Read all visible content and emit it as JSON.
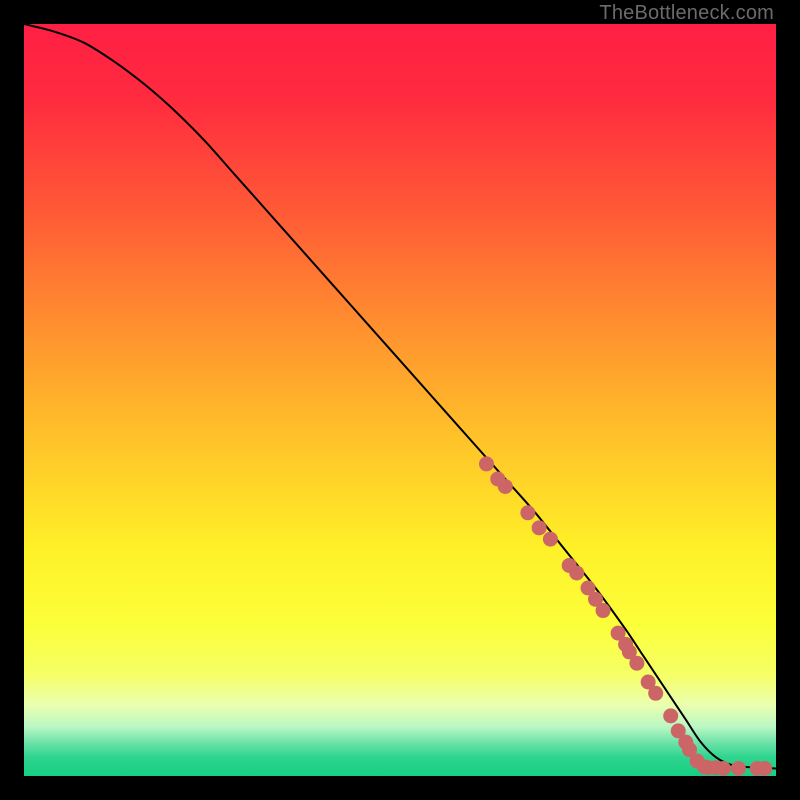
{
  "watermark": "TheBottleneck.com",
  "chart_data": {
    "type": "line",
    "title": "",
    "xlabel": "",
    "ylabel": "",
    "xlim": [
      0,
      100
    ],
    "ylim": [
      0,
      100
    ],
    "grid": false,
    "legend": false,
    "series": [
      {
        "name": "curve",
        "x": [
          0,
          4,
          8,
          12,
          16,
          20,
          24,
          28,
          32,
          36,
          40,
          44,
          48,
          52,
          56,
          60,
          64,
          68,
          72,
          76,
          80,
          82,
          84,
          86,
          88,
          90,
          92,
          94,
          96,
          98,
          100
        ],
        "y": [
          100,
          99,
          97.5,
          95,
          92,
          88.5,
          84.5,
          80,
          75.5,
          71,
          66.5,
          62,
          57.5,
          53,
          48.5,
          44,
          39.5,
          35,
          30,
          25,
          19.5,
          16.5,
          13.5,
          10.5,
          7.5,
          4.5,
          2.5,
          1.5,
          1.2,
          1.1,
          1.0
        ]
      }
    ],
    "markers": {
      "name": "dots",
      "color": "#cc6666",
      "points": [
        {
          "x": 61.5,
          "y": 41.5
        },
        {
          "x": 63.0,
          "y": 39.5
        },
        {
          "x": 64.0,
          "y": 38.5
        },
        {
          "x": 67.0,
          "y": 35.0
        },
        {
          "x": 68.5,
          "y": 33.0
        },
        {
          "x": 70.0,
          "y": 31.5
        },
        {
          "x": 72.5,
          "y": 28.0
        },
        {
          "x": 73.5,
          "y": 27.0
        },
        {
          "x": 75.0,
          "y": 25.0
        },
        {
          "x": 76.0,
          "y": 23.5
        },
        {
          "x": 77.0,
          "y": 22.0
        },
        {
          "x": 79.0,
          "y": 19.0
        },
        {
          "x": 80.0,
          "y": 17.5
        },
        {
          "x": 80.5,
          "y": 16.5
        },
        {
          "x": 81.5,
          "y": 15.0
        },
        {
          "x": 83.0,
          "y": 12.5
        },
        {
          "x": 84.0,
          "y": 11.0
        },
        {
          "x": 86.0,
          "y": 8.0
        },
        {
          "x": 87.0,
          "y": 6.0
        },
        {
          "x": 88.0,
          "y": 4.5
        },
        {
          "x": 88.5,
          "y": 3.5
        },
        {
          "x": 89.5,
          "y": 2.0
        },
        {
          "x": 90.5,
          "y": 1.2
        },
        {
          "x": 91.0,
          "y": 1.1
        },
        {
          "x": 92.0,
          "y": 1.1
        },
        {
          "x": 93.0,
          "y": 1.0
        },
        {
          "x": 95.0,
          "y": 1.0
        },
        {
          "x": 97.5,
          "y": 1.0
        },
        {
          "x": 98.5,
          "y": 1.0
        }
      ]
    },
    "background_gradient": {
      "stops": [
        {
          "offset": 0.0,
          "color": "#ff1f44"
        },
        {
          "offset": 0.1,
          "color": "#ff2b3f"
        },
        {
          "offset": 0.25,
          "color": "#ff5a36"
        },
        {
          "offset": 0.4,
          "color": "#ff8f2f"
        },
        {
          "offset": 0.55,
          "color": "#ffc229"
        },
        {
          "offset": 0.7,
          "color": "#fff128"
        },
        {
          "offset": 0.8,
          "color": "#fbff3a"
        },
        {
          "offset": 0.865,
          "color": "#f6ff66"
        },
        {
          "offset": 0.905,
          "color": "#eaffaf"
        },
        {
          "offset": 0.935,
          "color": "#b9f7c3"
        },
        {
          "offset": 0.955,
          "color": "#6fe3a9"
        },
        {
          "offset": 0.975,
          "color": "#2fd48f"
        },
        {
          "offset": 1.0,
          "color": "#16cf83"
        }
      ]
    }
  }
}
